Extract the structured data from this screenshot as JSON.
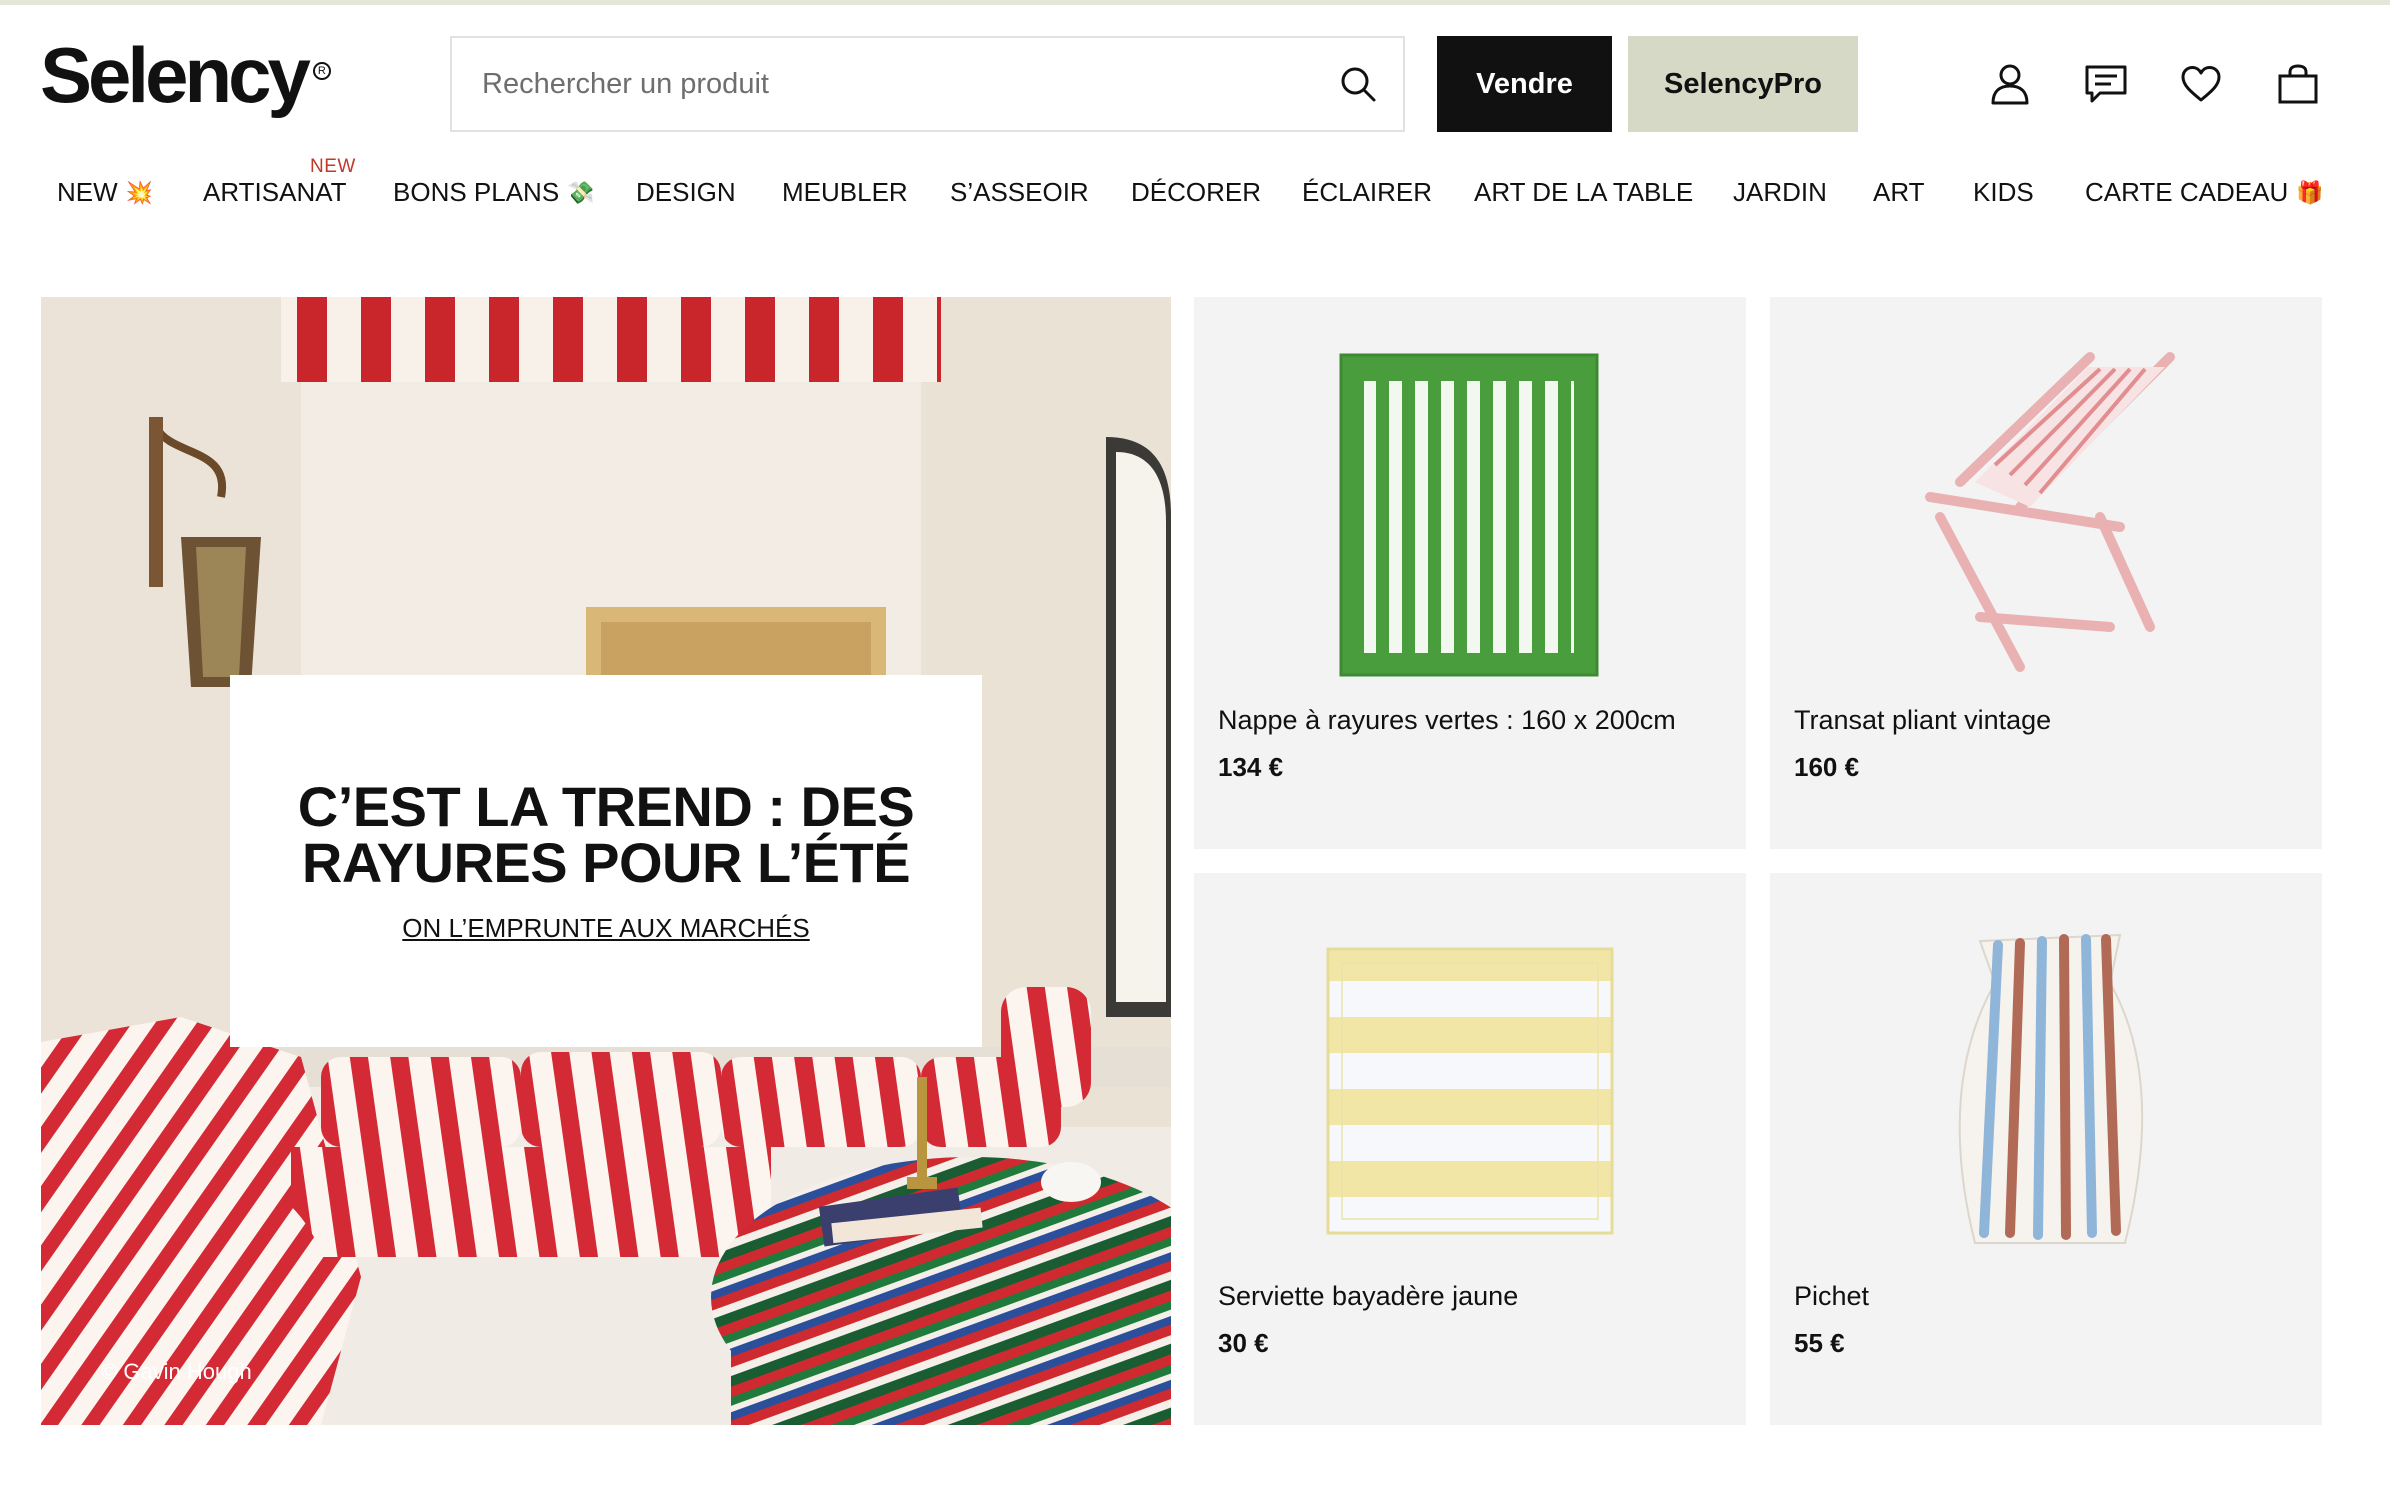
{
  "header": {
    "logo": "Selency",
    "search_placeholder": "Rechercher un produit",
    "sell_button": "Vendre",
    "pro_button": "SelencyPro",
    "icons": [
      "account-icon",
      "messages-icon",
      "heart-icon",
      "bag-icon"
    ]
  },
  "nav": {
    "items": [
      {
        "label": "NEW",
        "emoji": "💥"
      },
      {
        "label": "ARTISANAT",
        "badge": "NEW"
      },
      {
        "label": "BONS PLANS",
        "emoji": "💸"
      },
      {
        "label": "DESIGN"
      },
      {
        "label": "MEUBLER"
      },
      {
        "label": "S’ASSEOIR"
      },
      {
        "label": "DÉCORER"
      },
      {
        "label": "ÉCLAIRER"
      },
      {
        "label": "ART DE LA TABLE"
      },
      {
        "label": "JARDIN"
      },
      {
        "label": "ART"
      },
      {
        "label": "KIDS"
      },
      {
        "label": "CARTE CADEAU",
        "emoji": "🎁"
      }
    ]
  },
  "hero": {
    "title": "C’EST LA TREND : DES RAYURES POUR L’ÉTÉ",
    "link": "ON L’EMPRUNTE AUX MARCHÉS",
    "credit": "© Gavin Hough"
  },
  "products": [
    {
      "name": "Nappe à rayures vertes : 160 x 200cm",
      "price": "134 €"
    },
    {
      "name": "Transat pliant vintage",
      "price": "160 €"
    },
    {
      "name": "Serviette bayadère jaune",
      "price": "30 €"
    },
    {
      "name": "Pichet",
      "price": "55 €"
    }
  ],
  "colors": {
    "accent_dark": "#111111",
    "pro_bg": "#d6d9c6",
    "card_bg": "#f3f3f3",
    "new_badge": "#c0392b"
  }
}
